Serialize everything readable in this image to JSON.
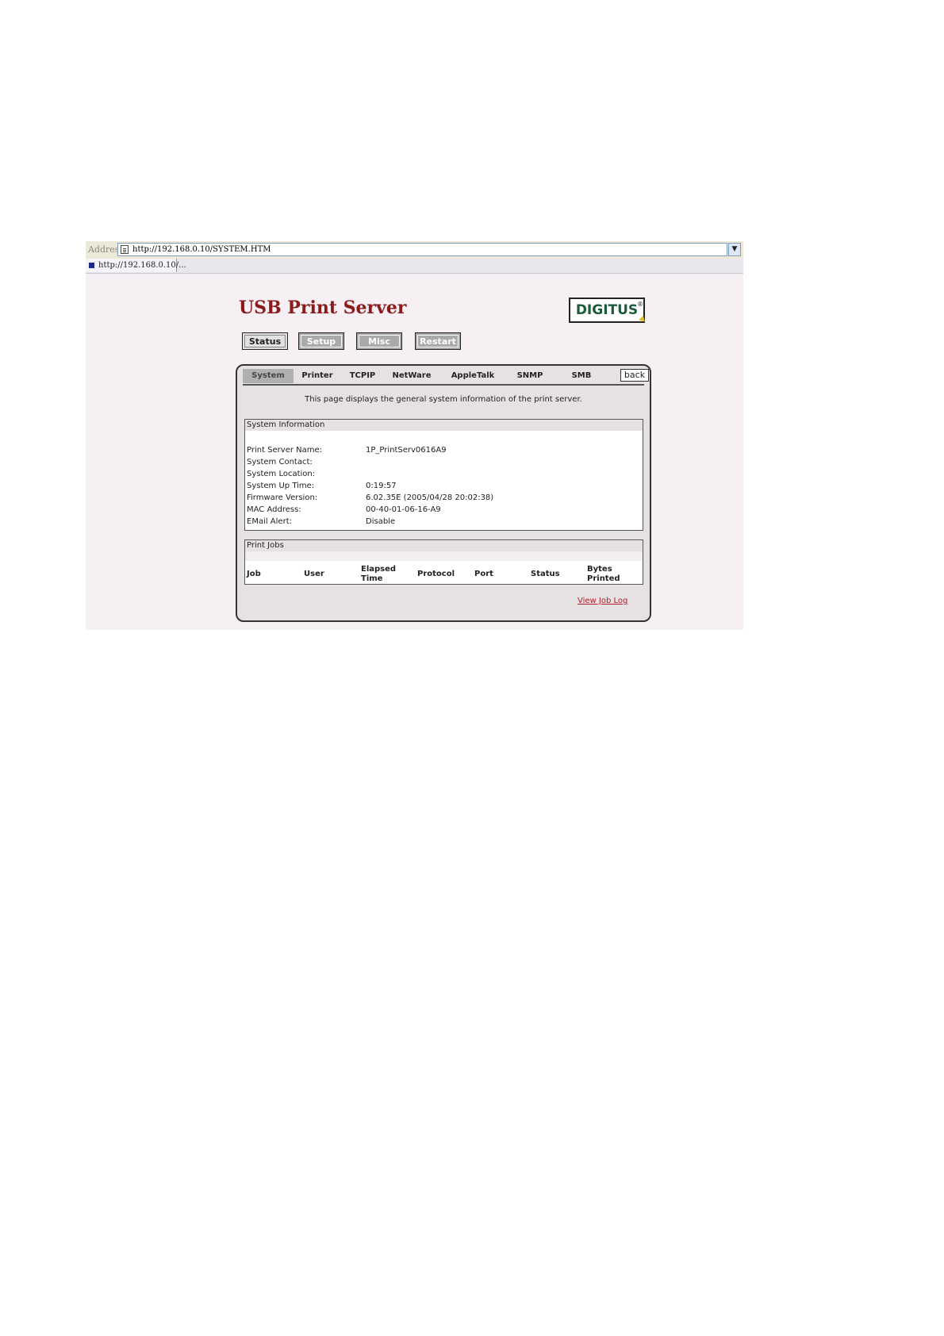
{
  "browser": {
    "address_label": "Address",
    "url": "http://192.168.0.10/SYSTEM.HTM",
    "tab_label": "http://192.168.0.10/..."
  },
  "header": {
    "title": "USB Print Server",
    "logo": "DIGITUS"
  },
  "nav": {
    "status": "Status",
    "setup": "Setup",
    "misc": "Misc",
    "restart": "Restart",
    "active": "Status"
  },
  "subnav": {
    "tabs": [
      "System",
      "Printer",
      "TCPIP",
      "NetWare",
      "AppleTalk",
      "SNMP",
      "SMB"
    ],
    "selected": "System",
    "back": "back"
  },
  "description": "This page displays the general system information of the print server.",
  "system_info": {
    "heading": "System Information",
    "rows": [
      {
        "label": "Print Server Name:",
        "value": "1P_PrintServ0616A9"
      },
      {
        "label": "System Contact:",
        "value": ""
      },
      {
        "label": "System Location:",
        "value": ""
      },
      {
        "label": "System Up Time:",
        "value": "0:19:57"
      },
      {
        "label": "Firmware Version:",
        "value": "6.02.35E (2005/04/28 20:02:38)"
      },
      {
        "label": "MAC Address:",
        "value": "00-40-01-06-16-A9"
      },
      {
        "label": "EMail Alert:",
        "value": "Disable"
      }
    ]
  },
  "print_jobs": {
    "heading": "Print Jobs",
    "columns": {
      "job": "Job",
      "user": "User",
      "elapsed_1": "Elapsed",
      "elapsed_2": "Time",
      "protocol": "Protocol",
      "port": "Port",
      "status": "Status",
      "bytes_1": "Bytes",
      "bytes_2": "Printed"
    }
  },
  "job_log_link": "View Job Log",
  "colors": {
    "title": "#8b1a1a",
    "link": "#b0202a",
    "background": "#f6f0f4",
    "panel": "#e6e2e4"
  }
}
